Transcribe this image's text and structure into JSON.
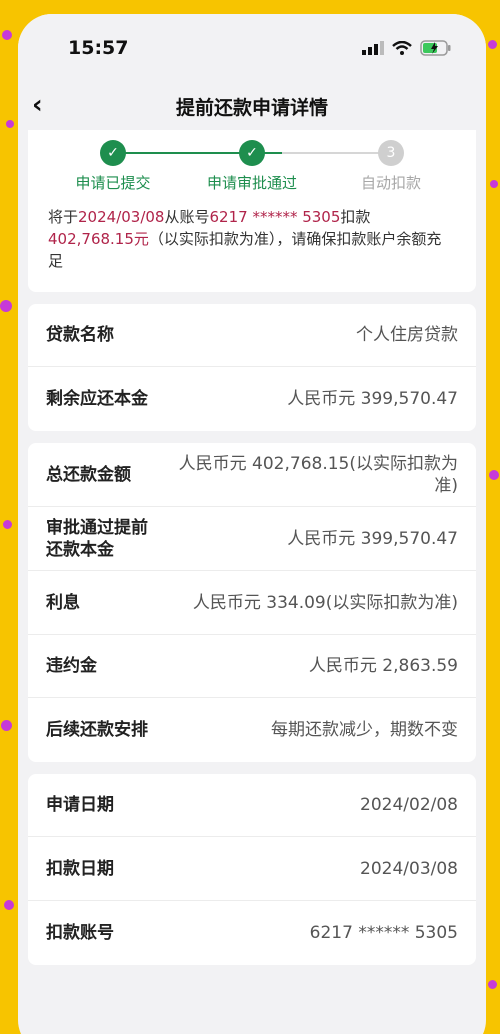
{
  "status_bar": {
    "time": "15:57"
  },
  "nav": {
    "title": "提前还款申请详情",
    "back_icon": "chevron-left-icon"
  },
  "steps": [
    {
      "label": "申请已提交",
      "state": "done",
      "icon": "check-icon"
    },
    {
      "label": "申请审批通过",
      "state": "done",
      "icon": "check-icon"
    },
    {
      "label": "自动扣款",
      "state": "todo",
      "number": "3"
    }
  ],
  "notice": {
    "p1": "将于",
    "date": "2024/03/08",
    "p2": "从账号",
    "account": "6217 ****** 5305",
    "p3": "扣款",
    "amount": "402,768.15元",
    "p4": "（以实际扣款为准），请确保扣款账户余额充足"
  },
  "section1": [
    {
      "label": "贷款名称",
      "value": "个人住房贷款"
    },
    {
      "label": "剩余应还本金",
      "value": "人民币元 399,570.47"
    }
  ],
  "section2": [
    {
      "label": "总还款金额",
      "value": "人民币元 402,768.15(以实际扣款为准)"
    },
    {
      "label": "审批通过提前还款本金",
      "value": "人民币元 399,570.47"
    },
    {
      "label": "利息",
      "value": "人民币元 334.09(以实际扣款为准)"
    },
    {
      "label": "违约金",
      "value": "人民币元 2,863.59"
    },
    {
      "label": "后续还款安排",
      "value": "每期还款减少，期数不变"
    }
  ],
  "section3": [
    {
      "label": "申请日期",
      "value": "2024/02/08"
    },
    {
      "label": "扣款日期",
      "value": "2024/03/08"
    },
    {
      "label": "扣款账号",
      "value": "6217 ****** 5305"
    }
  ],
  "colors": {
    "accent": "#1e8e4e",
    "highlight": "#b0244a",
    "background": "#f7c400"
  }
}
